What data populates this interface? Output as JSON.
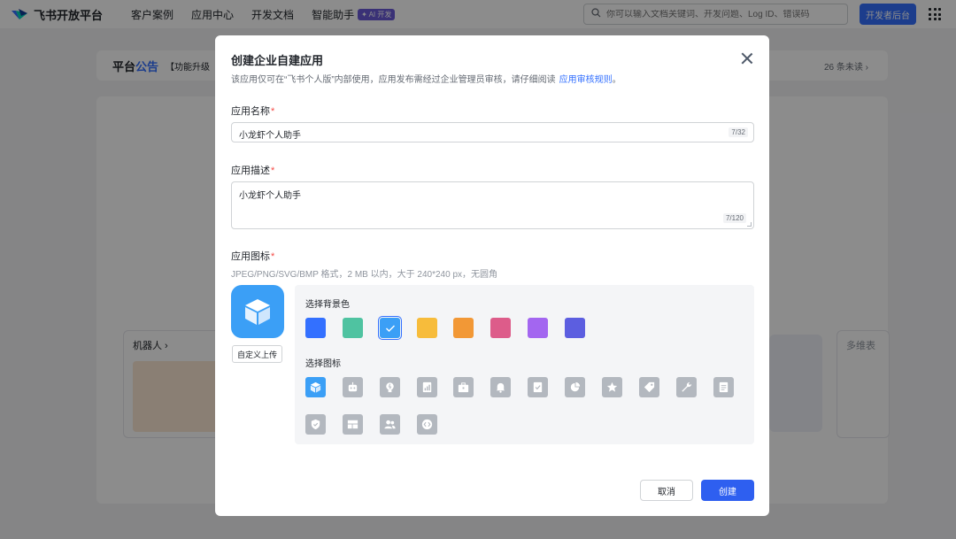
{
  "topbar": {
    "brand": "飞书开放平台",
    "nav": [
      "客户案例",
      "应用中心",
      "开发文档",
      "智能助手"
    ],
    "ai_badge": "✦ AI 开发",
    "search_placeholder": "你可以输入文档关键词、开发问题、Log ID、错误码",
    "dev_button": "开发者后台"
  },
  "notice": {
    "title_a": "平台",
    "title_b": "公告",
    "text": "【功能升级",
    "count": "26 条未读 ›"
  },
  "background_cards": {
    "left_title": "机器人 ›",
    "right_title": "多维表"
  },
  "dialog": {
    "title": "创建企业自建应用",
    "description": "该应用仅可在“飞书个人版”内部使用，应用发布需经过企业管理员审核，请仔细阅读",
    "link": "应用审核规则",
    "link_suffix": "。",
    "name_label": "应用名称",
    "name_value": "小龙虾个人助手",
    "name_counter": "7/32",
    "desc_label": "应用描述",
    "desc_value": "小龙虾个人助手",
    "desc_counter": "7/120",
    "icon_label": "应用图标",
    "required_mark": "*",
    "icon_hint": "JPEG/PNG/SVG/BMP 格式，2 MB 以内，大于 240*240 px，无圆角",
    "upload_button": "自定义上传",
    "bg_color_label": "选择背景色",
    "icon_select_label": "选择图标",
    "bg_colors": [
      "#3370ff",
      "#4fc3a1",
      "#3b9ff6",
      "#f7bc3b",
      "#f29836",
      "#dd5c8a",
      "#a366f0",
      "#5c5ee0"
    ],
    "selected_bg_index": 2,
    "icons": [
      "cube-icon",
      "robot-icon",
      "lightbulb-icon",
      "document-chart-icon",
      "toolbox-icon",
      "bell-icon",
      "checklist-icon",
      "pie-chart-icon",
      "star-icon",
      "tag-icon",
      "wrench-icon",
      "document-icon",
      "shield-check-icon",
      "layout-icon",
      "people-icon",
      "code-icon"
    ],
    "selected_icon_index": 0,
    "cancel_button": "取消",
    "create_button": "创建"
  }
}
